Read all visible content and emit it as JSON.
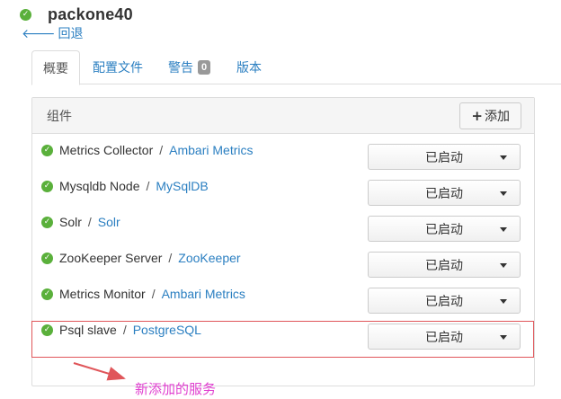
{
  "host": {
    "name": "packone40",
    "status_icon": "check-circle-icon",
    "status_color": "#5ab03b"
  },
  "back": {
    "label": "回退",
    "icon": "arrow-left-icon"
  },
  "tabs": [
    {
      "label": "概要",
      "active": true
    },
    {
      "label": "配置文件",
      "active": false
    },
    {
      "label": "警告",
      "active": false,
      "badge": "0"
    },
    {
      "label": "版本",
      "active": false
    }
  ],
  "components": {
    "title": "组件",
    "add_label": "添加",
    "add_icon": "plus-icon",
    "rows": [
      {
        "component": "Metrics Collector",
        "separator": "/",
        "service": "Ambari Metrics",
        "state": "已启动"
      },
      {
        "component": "Mysqldb Node",
        "separator": "/",
        "service": "MySqlDB",
        "state": "已启动"
      },
      {
        "component": "Solr",
        "separator": "/",
        "service": "Solr",
        "state": "已启动"
      },
      {
        "component": "ZooKeeper Server",
        "separator": "/",
        "service": "ZooKeeper",
        "state": "已启动"
      },
      {
        "component": "Metrics Monitor",
        "separator": "/",
        "service": "Ambari Metrics",
        "state": "已启动"
      },
      {
        "component": "Psql slave",
        "separator": "/",
        "service": "PostgreSQL",
        "state": "已启动"
      }
    ]
  },
  "annotation": {
    "text": "新添加的服务",
    "color": "#e040d0",
    "box_color": "#e0565a"
  },
  "colors": {
    "link": "#2b7fc1",
    "ok": "#5ab03b"
  }
}
